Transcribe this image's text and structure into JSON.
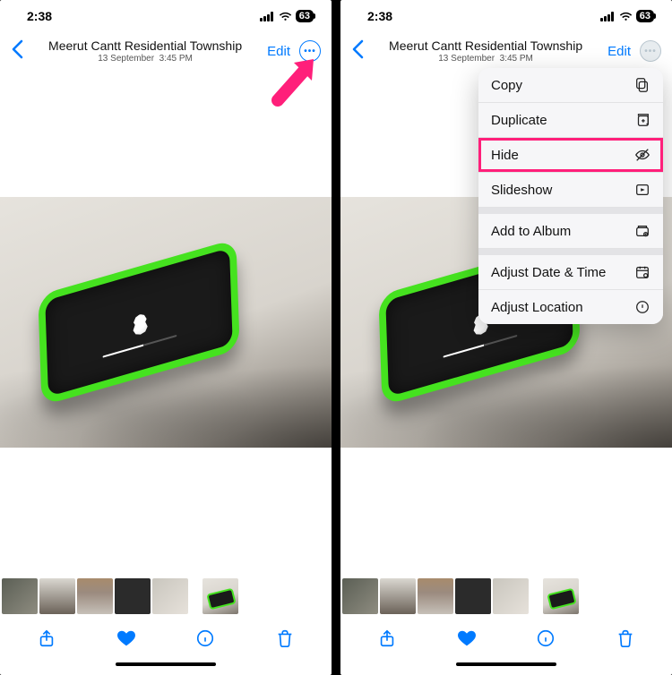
{
  "status": {
    "time": "2:38",
    "battery": "63"
  },
  "nav": {
    "title": "Meerut Cantt Residential Township",
    "subtitle_date": "13 September",
    "subtitle_time": "3:45 PM",
    "edit": "Edit"
  },
  "menu": {
    "copy": "Copy",
    "duplicate": "Duplicate",
    "hide": "Hide",
    "slideshow": "Slideshow",
    "add_album": "Add to Album",
    "adjust_date": "Adjust Date & Time",
    "adjust_loc": "Adjust Location"
  }
}
